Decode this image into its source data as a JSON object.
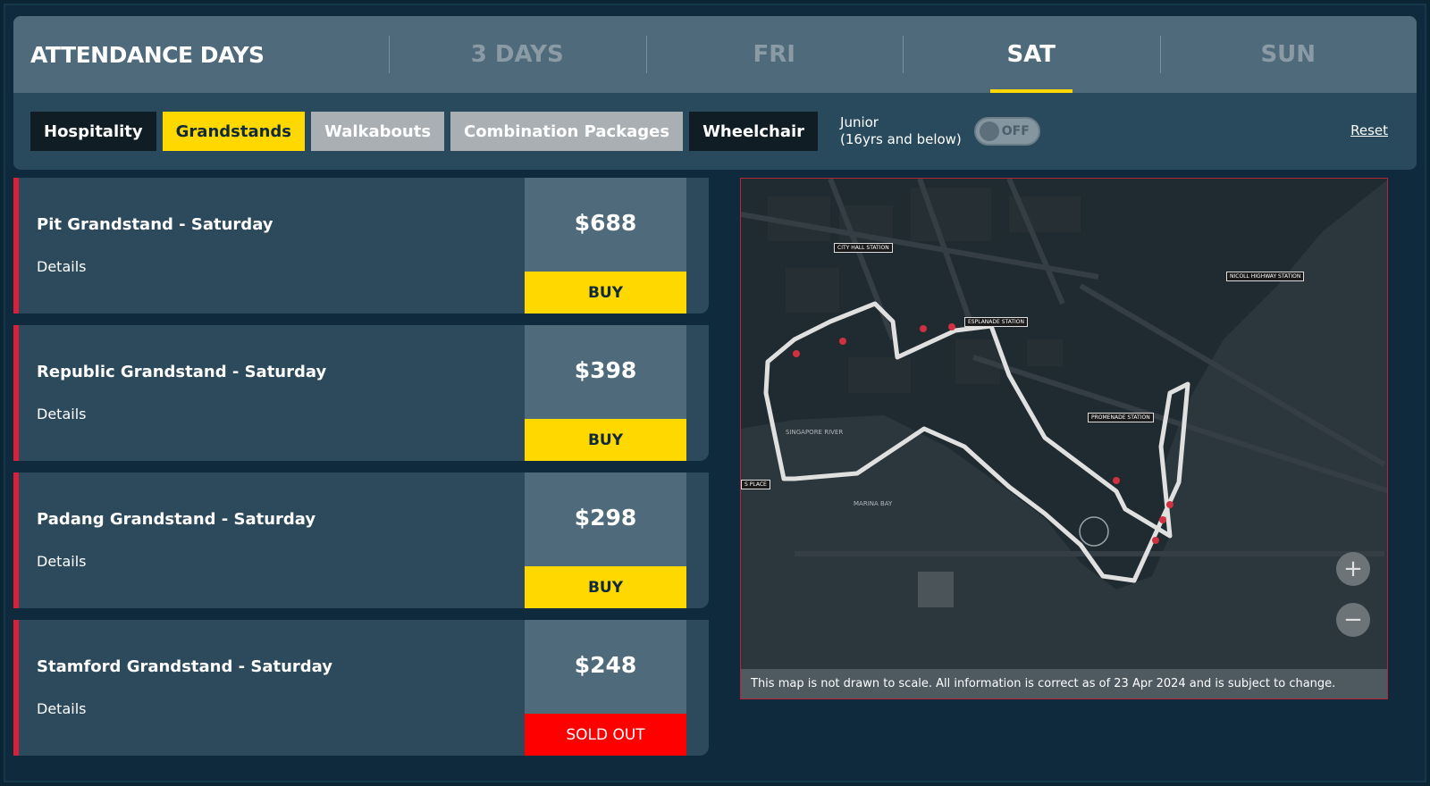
{
  "header": {
    "title": "ATTENDANCE DAYS",
    "day_tabs": [
      {
        "label": "3 DAYS",
        "active": false
      },
      {
        "label": "FRI",
        "active": false
      },
      {
        "label": "SAT",
        "active": true
      },
      {
        "label": "SUN",
        "active": false
      }
    ]
  },
  "filters": {
    "chips": [
      {
        "label": "Hospitality",
        "style": "dark"
      },
      {
        "label": "Grandstands",
        "style": "yellow"
      },
      {
        "label": "Walkabouts",
        "style": "grey"
      },
      {
        "label": "Combination Packages",
        "style": "grey"
      },
      {
        "label": "Wheelchair",
        "style": "dark"
      }
    ],
    "junior_line1": "Junior",
    "junior_line2": "(16yrs and below)",
    "toggle_label": "OFF",
    "reset_label": "Reset"
  },
  "tickets": [
    {
      "name": "Pit Grandstand - Saturday",
      "details": "Details",
      "price": "$688",
      "action": "BUY",
      "sold_out": false
    },
    {
      "name": "Republic Grandstand - Saturday",
      "details": "Details",
      "price": "$398",
      "action": "BUY",
      "sold_out": false
    },
    {
      "name": "Padang Grandstand - Saturday",
      "details": "Details",
      "price": "$298",
      "action": "BUY",
      "sold_out": false
    },
    {
      "name": "Stamford Grandstand - Saturday",
      "details": "Details",
      "price": "$248",
      "action": "SOLD OUT",
      "sold_out": true
    }
  ],
  "map": {
    "note": "This map is not drawn to scale. All information is correct as of 23 Apr 2024 and is subject to change.",
    "zoom_in": "+",
    "zoom_out": "−",
    "labels": {
      "river": "SINGAPORE RIVER",
      "bay": "MARINA BAY",
      "city_hall": "CITY HALL STATION",
      "esplanade": "ESPLANADE STATION",
      "promenade": "PROMENADE STATION",
      "nicoll": "NICOLL HIGHWAY STATION",
      "raffles": "S PLACE"
    }
  },
  "colors": {
    "accent_yellow": "#ffd800",
    "sold_out_red": "#ff0000",
    "ticket_stripe": "#d9203a"
  }
}
